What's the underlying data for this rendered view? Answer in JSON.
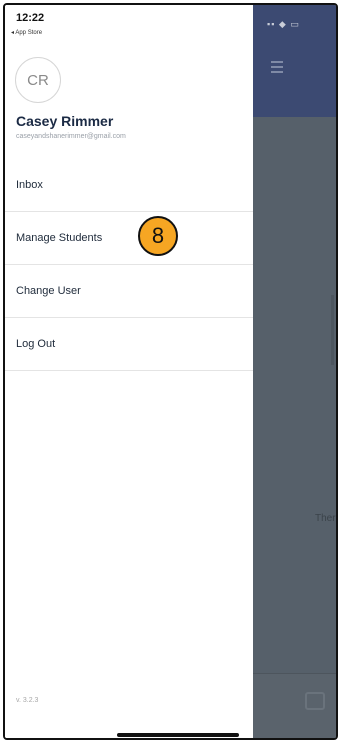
{
  "status_bar": {
    "time": "12:22",
    "back_app": "◂ App Store"
  },
  "drawer": {
    "avatar_initials": "CR",
    "user_name": "Casey Rimmer",
    "user_email": "caseyandshanerimmer@gmail.com",
    "menu": [
      {
        "label": "Inbox"
      },
      {
        "label": "Manage Students"
      },
      {
        "label": "Change User"
      },
      {
        "label": "Log Out"
      }
    ],
    "version": "v. 3.2.3"
  },
  "annotation": {
    "step_number": "8"
  },
  "background_app": {
    "partial_text": "Ther"
  },
  "colors": {
    "badge": "#f6a623",
    "header": "#3c4a72",
    "overlay": "#56606a",
    "name_text": "#1b2a44"
  }
}
